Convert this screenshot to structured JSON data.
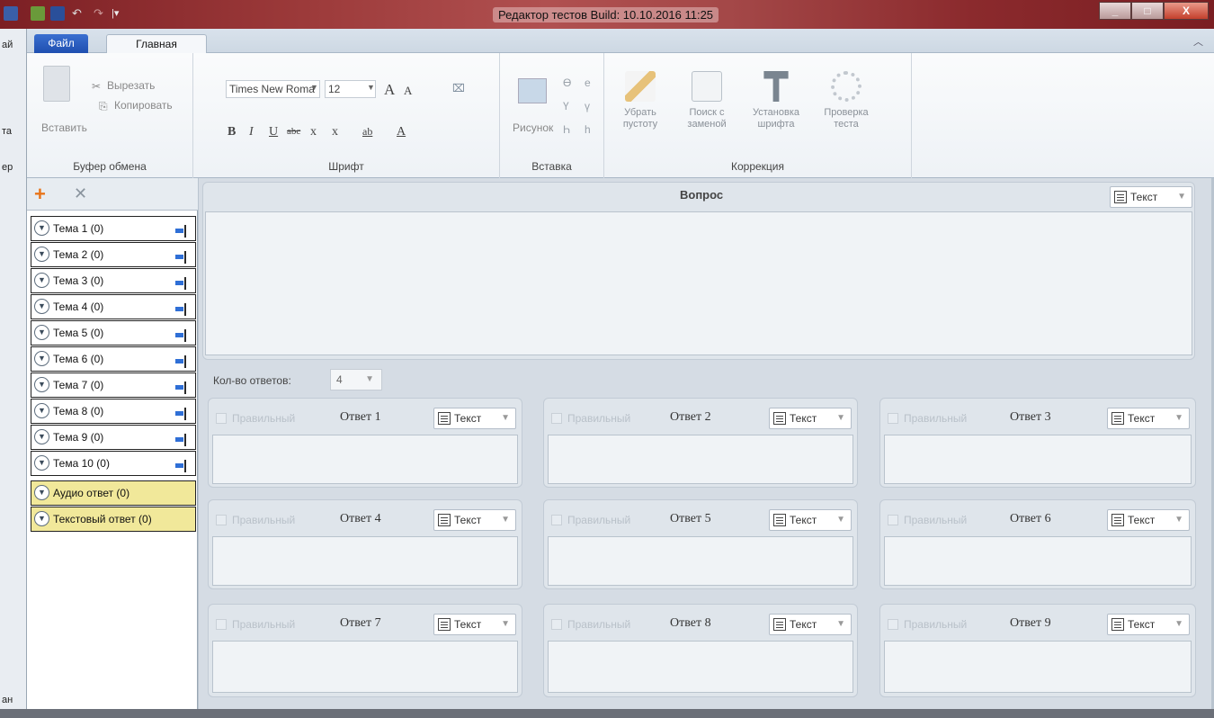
{
  "window": {
    "title": "Редактор тестов Build: 10.10.2016 11:25",
    "controls": [
      "_",
      "□",
      "X"
    ]
  },
  "background_app": {
    "fragments": [
      "ай",
      "та",
      "ер",
      "ан"
    ]
  },
  "tabs": {
    "file": "Файл",
    "home": "Главная"
  },
  "ribbon": {
    "clipboard": {
      "label": "Буфер обмена",
      "paste": "Вставить",
      "cut": "Вырезать",
      "copy": "Копировать"
    },
    "font": {
      "label": "Шрифт",
      "family": "Times New Roma",
      "size": "12",
      "grow": "A",
      "shrink": "A",
      "bold": "B",
      "italic": "I",
      "underline": "U",
      "strike": "abc",
      "subscript": "x",
      "superscript": "x",
      "highlight": "ab",
      "color": "A"
    },
    "insert": {
      "label": "Вставка",
      "picture": "Рисунок",
      "chars": [
        "Ө",
        "е",
        "Ү",
        "ү",
        "Һ",
        "һ"
      ]
    },
    "correction": {
      "label": "Коррекция",
      "clean_empty": [
        "Убрать",
        "пустоту"
      ],
      "find_replace": [
        "Поиск с",
        "заменой"
      ],
      "set_font": [
        "Установка",
        "шрифта"
      ],
      "check_test": [
        "Проверка",
        "теста"
      ]
    }
  },
  "topics": [
    {
      "label": "Тема 1 (0)"
    },
    {
      "label": "Тема 2 (0)"
    },
    {
      "label": "Тема 3 (0)"
    },
    {
      "label": "Тема 4 (0)"
    },
    {
      "label": "Тема 5 (0)"
    },
    {
      "label": "Тема 6 (0)"
    },
    {
      "label": "Тема 7 (0)"
    },
    {
      "label": "Тема 8 (0)"
    },
    {
      "label": "Тема 9 (0)"
    },
    {
      "label": "Тема 10 (0)"
    }
  ],
  "special_topics": [
    {
      "label": "Аудио ответ (0)"
    },
    {
      "label": "Текстовый ответ (0)"
    }
  ],
  "question": {
    "heading": "Вопрос",
    "type": "Текст",
    "text": ""
  },
  "answers_count": {
    "label": "Кол-во ответов:",
    "value": "4"
  },
  "answers": [
    {
      "title": "Ответ 1",
      "correct_label": "Правильный",
      "type": "Текст"
    },
    {
      "title": "Ответ 2",
      "correct_label": "Правильный",
      "type": "Текст"
    },
    {
      "title": "Ответ 3",
      "correct_label": "Правильный",
      "type": "Текст"
    },
    {
      "title": "Ответ 4",
      "correct_label": "Правильный",
      "type": "Текст"
    },
    {
      "title": "Ответ 5",
      "correct_label": "Правильный",
      "type": "Текст"
    },
    {
      "title": "Ответ 6",
      "correct_label": "Правильный",
      "type": "Текст"
    },
    {
      "title": "Ответ 7",
      "correct_label": "Правильный",
      "type": "Текст"
    },
    {
      "title": "Ответ 8",
      "correct_label": "Правильный",
      "type": "Текст"
    },
    {
      "title": "Ответ 9",
      "correct_label": "Правильный",
      "type": "Текст"
    }
  ],
  "colors": {
    "titlebar": "#8b2a2d",
    "file_tab": "#2a5cc0",
    "add_icon": "#e8741a",
    "special_topic": "#f1e89a"
  }
}
